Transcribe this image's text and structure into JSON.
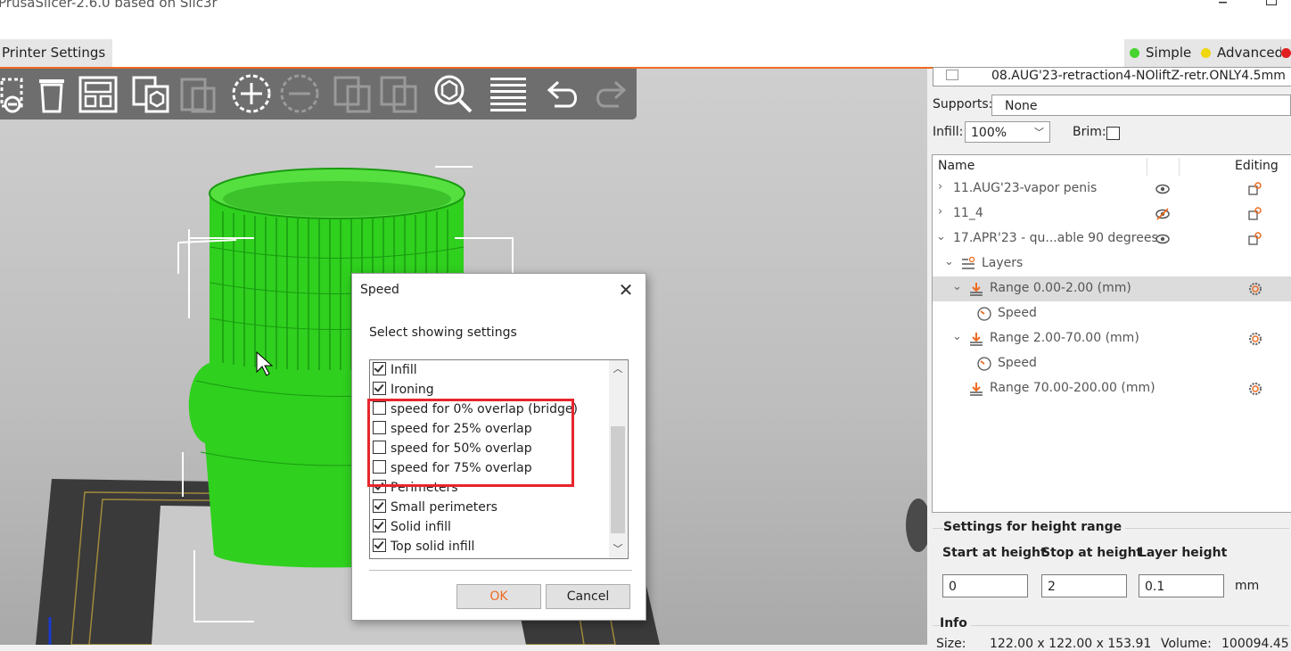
{
  "window": {
    "title": "PrusaSlicer-2.6.0 based on Slic3r"
  },
  "tabs": {
    "printer_settings": "Printer Settings"
  },
  "modes": {
    "simple": {
      "label": "Simple",
      "color": "#47d430"
    },
    "advanced": {
      "label": "Advanced",
      "color": "#f0d60d"
    },
    "expert": {
      "color": "#e02020"
    }
  },
  "accent_color": "#ed6b21",
  "toolbar": {
    "icons": [
      "delete-icon",
      "delete-all-icon",
      "arrange-icon",
      "copy-icon",
      "paste-icon",
      "add-instance-icon",
      "remove-instance-icon",
      "split-objects-icon",
      "split-parts-icon",
      "search-icon",
      "layers-editing-icon",
      "undo-icon",
      "redo-icon"
    ]
  },
  "dialog": {
    "title": "Speed",
    "subtitle": "Select showing settings",
    "items": [
      {
        "label": "Infill",
        "checked": true
      },
      {
        "label": "Ironing",
        "checked": true
      },
      {
        "label": "speed for 0% overlap (bridge)",
        "checked": false
      },
      {
        "label": "speed for 25% overlap",
        "checked": false
      },
      {
        "label": "speed for 50% overlap",
        "checked": false
      },
      {
        "label": "speed for 75% overlap",
        "checked": false
      },
      {
        "label": "Perimeters",
        "checked": true
      },
      {
        "label": "Small perimeters",
        "checked": true
      },
      {
        "label": "Solid infill",
        "checked": true
      },
      {
        "label": "Top solid infill",
        "checked": true
      }
    ],
    "ok_label": "OK",
    "cancel_label": "Cancel"
  },
  "panel": {
    "preset_name": "08.AUG'23-retraction4-NOliftZ-retr.ONLY4.5mm",
    "supports_label": "Supports:",
    "supports_value": "None",
    "infill_label": "Infill:",
    "infill_value": "100%",
    "brim_label": "Brim:",
    "tree_header": {
      "name": "Name",
      "editing": "Editing"
    },
    "tree_rows": [
      {
        "label": "11.AUG'23-vapor penis"
      },
      {
        "label": "11_4"
      },
      {
        "label": "17.APR'23 - qu...able 90 degrees"
      },
      {
        "label": "Layers"
      },
      {
        "label": "Range 0.00-2.00 (mm)"
      },
      {
        "label": "Speed"
      },
      {
        "label": "Range 2.00-70.00 (mm)"
      },
      {
        "label": "Speed"
      },
      {
        "label": "Range 70.00-200.00 (mm)"
      }
    ],
    "height_range": {
      "title": "Settings for height range",
      "start_label": "Start at height",
      "stop_label": "Stop at height",
      "layer_label": "Layer height",
      "start_value": "0",
      "stop_value": "2",
      "layer_value": "0.1",
      "unit": "mm"
    },
    "info": {
      "title": "Info",
      "size_label": "Size:",
      "size_value": "122.00 x 122.00 x 153.91",
      "volume_label": "Volume:",
      "volume_value": "100094.45"
    }
  }
}
